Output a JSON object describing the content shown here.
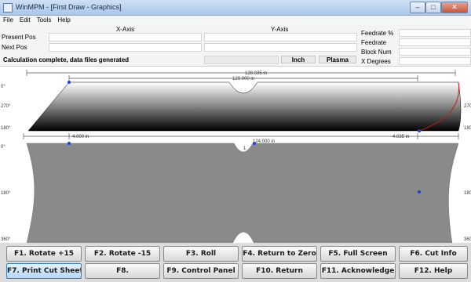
{
  "window": {
    "title": "WinMPM - [First Draw - Graphics]"
  },
  "menu": [
    "File",
    "Edit",
    "Tools",
    "Help"
  ],
  "info": {
    "x_axis_label": "X-Axis",
    "y_axis_label": "Y-Axis",
    "present_pos_label": "Present Pos",
    "next_pos_label": "Next Pos",
    "status_message": "Calculation complete, data files generated",
    "units_label": "Inch",
    "mode_label": "Plasma",
    "right_labels": [
      "Feedrate %",
      "Feedrate",
      "Block Num",
      "X Degrees"
    ]
  },
  "graphics": {
    "upper_view": {
      "overall_dimension": "128.035 in",
      "inner_dimension": "120.000 in",
      "left_offset": "4.000 in",
      "right_offset": "4.035 in",
      "y_axis_labels": [
        "0°",
        "270°",
        "180°"
      ],
      "y_axis_labels_right": [
        "270",
        "180"
      ]
    },
    "lower_view": {
      "center_dimension": "124.000 in",
      "center_label": "1",
      "y_axis_labels": [
        "0°",
        "180°",
        "360°"
      ],
      "y_axis_labels_right": [
        "180",
        "360"
      ]
    },
    "colors": {
      "shape_gray": "#8a8a8a",
      "upper_gradient_start": "#ffffff",
      "upper_gradient_end": "#000000",
      "point_blue": "#1f3fd8",
      "edge_red": "#c0201c",
      "dimension_line": "#555555"
    }
  },
  "function_keys": [
    {
      "label": "F1. Rotate +15",
      "active": false
    },
    {
      "label": "F2. Rotate -15",
      "active": false
    },
    {
      "label": "F3. Roll",
      "active": false
    },
    {
      "label": "F4. Return to Zero",
      "active": false
    },
    {
      "label": "F5. Full Screen",
      "active": false
    },
    {
      "label": "F6. Cut Info",
      "active": false
    },
    {
      "label": "F7. Print Cut Sheet",
      "active": true
    },
    {
      "label": "F8.",
      "active": false
    },
    {
      "label": "F9. Control Panel",
      "active": false
    },
    {
      "label": "F10. Return",
      "active": false
    },
    {
      "label": "F11. Acknowledge",
      "active": false
    },
    {
      "label": "F12. Help",
      "active": false
    }
  ]
}
